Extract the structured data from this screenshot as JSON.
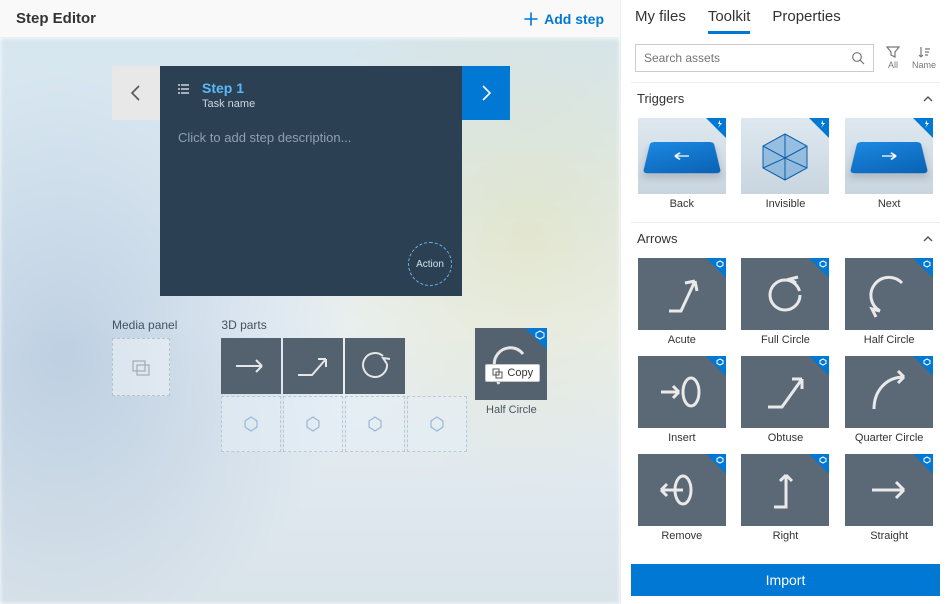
{
  "editor": {
    "title": "Step Editor",
    "add_step": "Add step",
    "step_title": "Step 1",
    "task_name": "Task name",
    "desc_placeholder": "Click to add step description...",
    "action_label": "Action",
    "media_panel_label": "Media panel",
    "parts_label": "3D parts",
    "copy_tooltip": "Copy",
    "drop_caption": "Half Circle"
  },
  "tabs": {
    "my_files": "My files",
    "toolkit": "Toolkit",
    "properties": "Properties"
  },
  "search": {
    "placeholder": "Search assets",
    "filter_all": "All",
    "sort_name": "Name"
  },
  "sections": {
    "triggers": "Triggers",
    "arrows": "Arrows"
  },
  "triggers": {
    "back": "Back",
    "invisible": "Invisible",
    "next": "Next"
  },
  "arrows": {
    "acute": "Acute",
    "full_circle": "Full Circle",
    "half_circle": "Half Circle",
    "insert": "Insert",
    "obtuse": "Obtuse",
    "quarter_circle": "Quarter Circle",
    "remove": "Remove",
    "right": "Right",
    "straight": "Straight"
  },
  "import_btn": "Import"
}
